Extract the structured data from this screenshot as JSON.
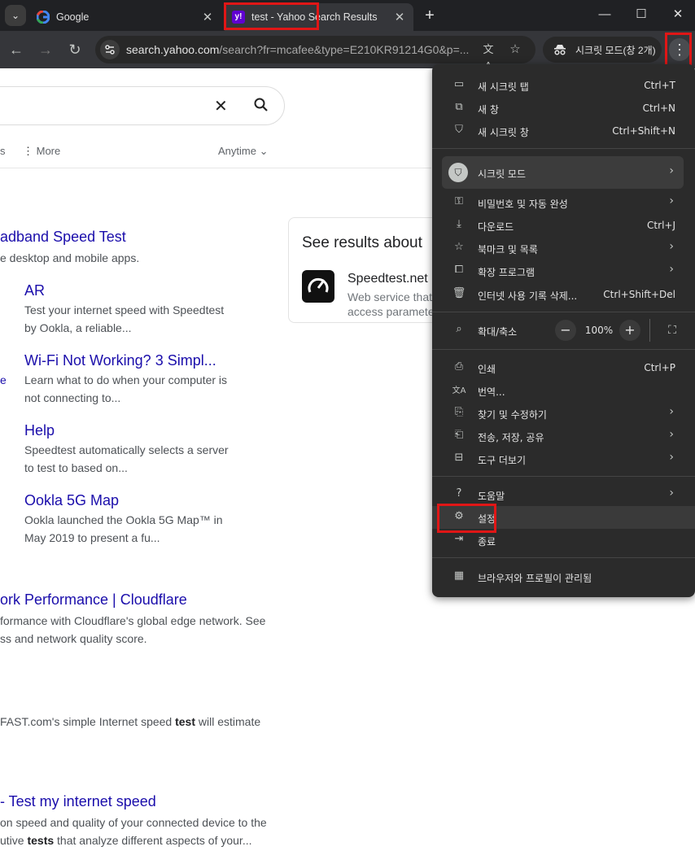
{
  "tabs": [
    {
      "title": "Google"
    },
    {
      "title": "test - Yahoo Search Results"
    }
  ],
  "toolbar": {
    "url_main": "search.yahoo.com",
    "url_rest": "/search?fr=mcafee&type=E210KR91214G0&p=...",
    "incognito_chip": "시크릿 모드(창 2개)"
  },
  "page": {
    "filters": {
      "more": "More",
      "anytime": "Anytime"
    },
    "results": [
      {
        "title": "adband Speed Test",
        "snippet": [
          "e desktop and mobile apps."
        ]
      },
      {
        "title": "AR",
        "snippet": [
          "Test your internet speed with Speedtest",
          "by Ookla, a reliable..."
        ]
      },
      {
        "title": "Wi-Fi Not Working? 3 Simpl...",
        "snippet": [
          "Learn what to do when your computer is",
          "not connecting to..."
        ]
      },
      {
        "title": "Help",
        "snippet": [
          "Speedtest automatically selects a server",
          "to test to based on..."
        ]
      },
      {
        "title": "Ookla 5G Map",
        "snippet": [
          "Ookla launched the Ookla 5G Map™ in",
          "May 2019 to present a fu..."
        ]
      },
      {
        "title": "ork Performance | Cloudflare",
        "snippet": [
          "formance with Cloudflare's global edge network. See",
          "ss and network quality score."
        ]
      },
      {
        "title": "",
        "snippet_pre": " FAST.com's simple Internet speed ",
        "snippet_bold": "test",
        "snippet_post": " will estimate"
      },
      {
        "title": "- Test my internet speed",
        "snippet_line1": "on speed and quality of your connected device to the",
        "snippet_pre": "utive ",
        "snippet_bold": "tests",
        "snippet_post": " that analyze different aspects of your..."
      }
    ],
    "side_card": {
      "heading": "See results about",
      "name": "Speedtest.net",
      "desc": [
        "Web service that",
        "access paramete"
      ]
    }
  },
  "menu": {
    "items_top": [
      {
        "label": "새 시크릿 탭",
        "shortcut": "Ctrl+T",
        "icon": "new-tab-icon"
      },
      {
        "label": "새 창",
        "shortcut": "Ctrl+N",
        "icon": "new-window-icon"
      },
      {
        "label": "새 시크릿 창",
        "shortcut": "Ctrl+Shift+N",
        "icon": "incognito-icon"
      }
    ],
    "incognito": {
      "label": "시크릿 모드"
    },
    "items_mid": [
      {
        "label": "비밀번호 및 자동 완성",
        "shortcut": "",
        "arrow": true
      },
      {
        "label": "다운로드",
        "shortcut": "Ctrl+J",
        "arrow": false
      },
      {
        "label": "북마크 및 목록",
        "shortcut": "",
        "arrow": true
      },
      {
        "label": "확장 프로그램",
        "shortcut": "",
        "arrow": true
      },
      {
        "label": "인터넷 사용 기록 삭제...",
        "shortcut": "Ctrl+Shift+Del",
        "arrow": false
      }
    ],
    "zoom": {
      "label": "확대/축소",
      "value": "100%",
      "minus": "−",
      "plus": "+"
    },
    "items_tools": [
      {
        "label": "인쇄",
        "shortcut": "Ctrl+P",
        "arrow": false
      },
      {
        "label": "번역...",
        "shortcut": "",
        "arrow": false
      },
      {
        "label": "찾기 및 수정하기",
        "shortcut": "",
        "arrow": true
      },
      {
        "label": "전송, 저장, 공유",
        "shortcut": "",
        "arrow": true
      },
      {
        "label": "도구 더보기",
        "shortcut": "",
        "arrow": true
      }
    ],
    "items_bottom": [
      {
        "label": "도움말",
        "arrow": true
      },
      {
        "label": "설정",
        "arrow": false
      },
      {
        "label": "종료",
        "arrow": false
      }
    ],
    "managed": {
      "label": "브라우저와 프로필이 관리됨"
    }
  },
  "colors": {
    "highlight": "#e01616",
    "link": "#1a0dab",
    "yahoo_purple": "#6001d2"
  }
}
